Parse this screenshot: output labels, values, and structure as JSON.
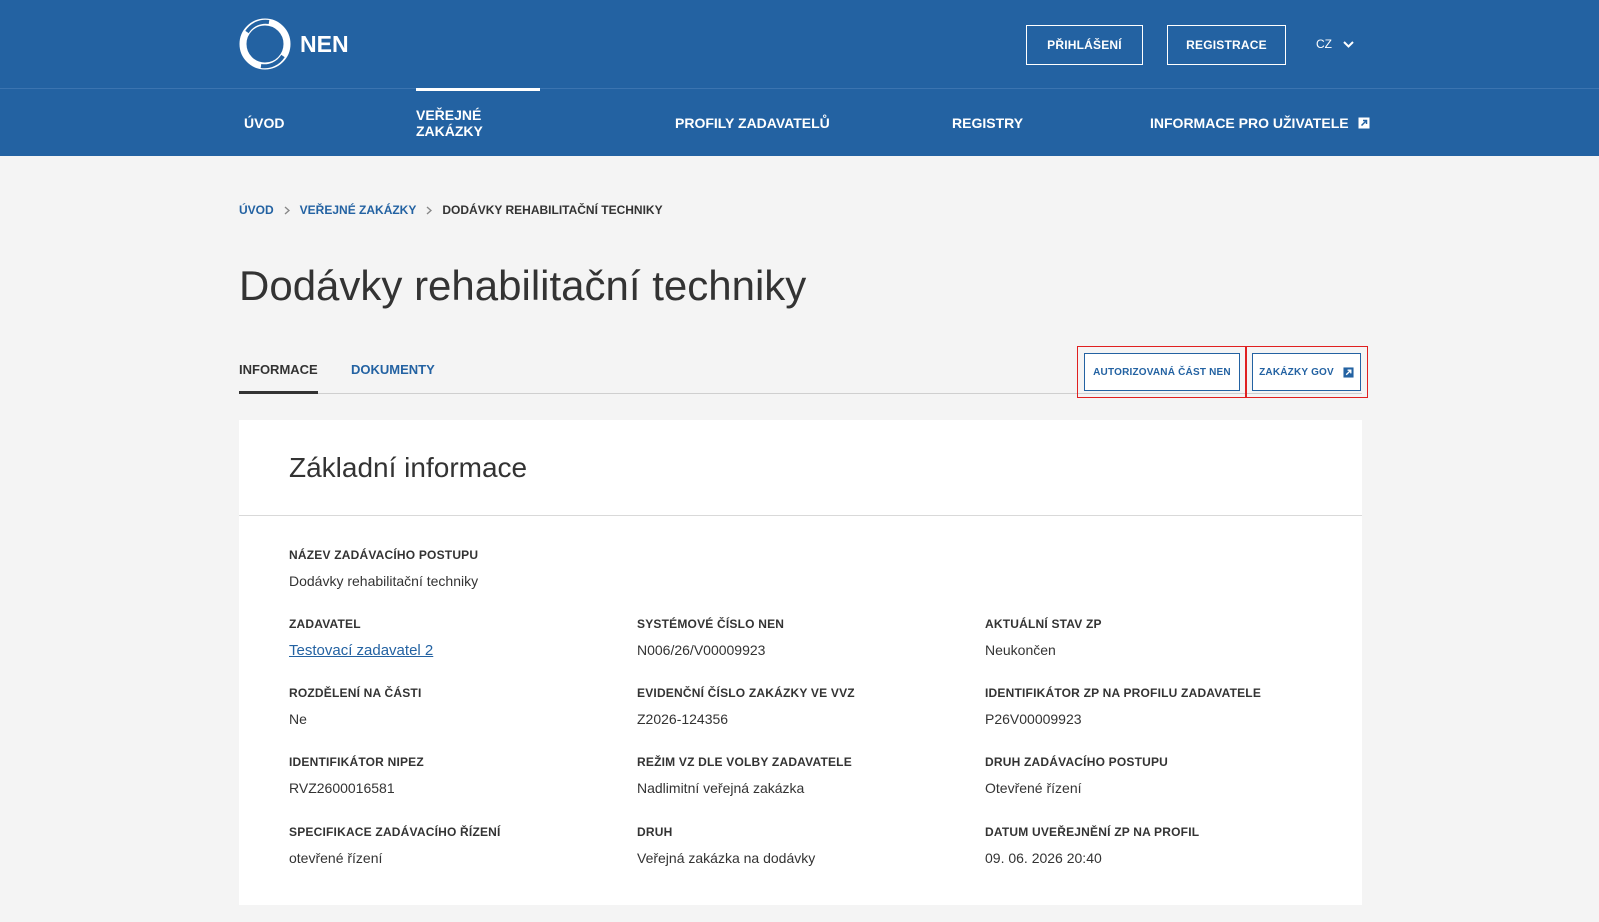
{
  "header": {
    "logo_text": "NEN",
    "login_label": "PŘIHLÁŠENÍ",
    "register_label": "REGISTRACE",
    "language": "CZ"
  },
  "nav": {
    "items": [
      {
        "label": "ÚVOD"
      },
      {
        "label": "VEŘEJNÉ ZAKÁZKY"
      },
      {
        "label": "PROFILY ZADAVATELŮ"
      },
      {
        "label": "REGISTRY"
      },
      {
        "label": "INFORMACE PRO UŽIVATELE"
      }
    ]
  },
  "breadcrumb": {
    "items": [
      "ÚVOD",
      "VEŘEJNÉ ZAKÁZKY",
      "DODÁVKY REHABILITAČNÍ TECHNIKY"
    ]
  },
  "page": {
    "title": "Dodávky rehabilitační techniky"
  },
  "tabs": {
    "info": "INFORMACE",
    "docs": "DOKUMENTY"
  },
  "actions": {
    "authorized": "AUTORIZOVANÁ ČÁST NEN",
    "gov": "ZAKÁZKY GOV"
  },
  "basic_info": {
    "title": "Základní informace",
    "fields": [
      {
        "label": "NÁZEV ZADÁVACÍHO POSTUPU",
        "value": "Dodávky rehabilitační techniky"
      },
      {
        "label": "ZADAVATEL",
        "value": "Testovací zadavatel 2"
      },
      {
        "label": "SYSTÉMOVÉ ČÍSLO NEN",
        "value": "N006/26/V00009923"
      },
      {
        "label": "AKTUÁLNÍ STAV ZP",
        "value": "Neukončen"
      },
      {
        "label": "ROZDĚLENÍ NA ČÁSTI",
        "value": "Ne"
      },
      {
        "label": "EVIDENČNÍ ČÍSLO ZAKÁZKY VE VVZ",
        "value": "Z2026-124356"
      },
      {
        "label": "IDENTIFIKÁTOR ZP NA PROFILU ZADAVATELE",
        "value": "P26V00009923"
      },
      {
        "label": "IDENTIFIKÁTOR NIPEZ",
        "value": "RVZ2600016581"
      },
      {
        "label": "REŽIM VZ DLE VOLBY ZADAVATELE",
        "value": "Nadlimitní veřejná zakázka"
      },
      {
        "label": "DRUH ZADÁVACÍHO POSTUPU",
        "value": "Otevřené řízení"
      },
      {
        "label": "SPECIFIKACE ZADÁVACÍHO ŘÍZENÍ",
        "value": "otevřené řízení"
      },
      {
        "label": "DRUH",
        "value": "Veřejná zakázka na dodávky"
      },
      {
        "label": "DATUM UVEŘEJNĚNÍ ZP NA PROFIL",
        "value": "09. 06. 2026 20:40"
      }
    ]
  }
}
